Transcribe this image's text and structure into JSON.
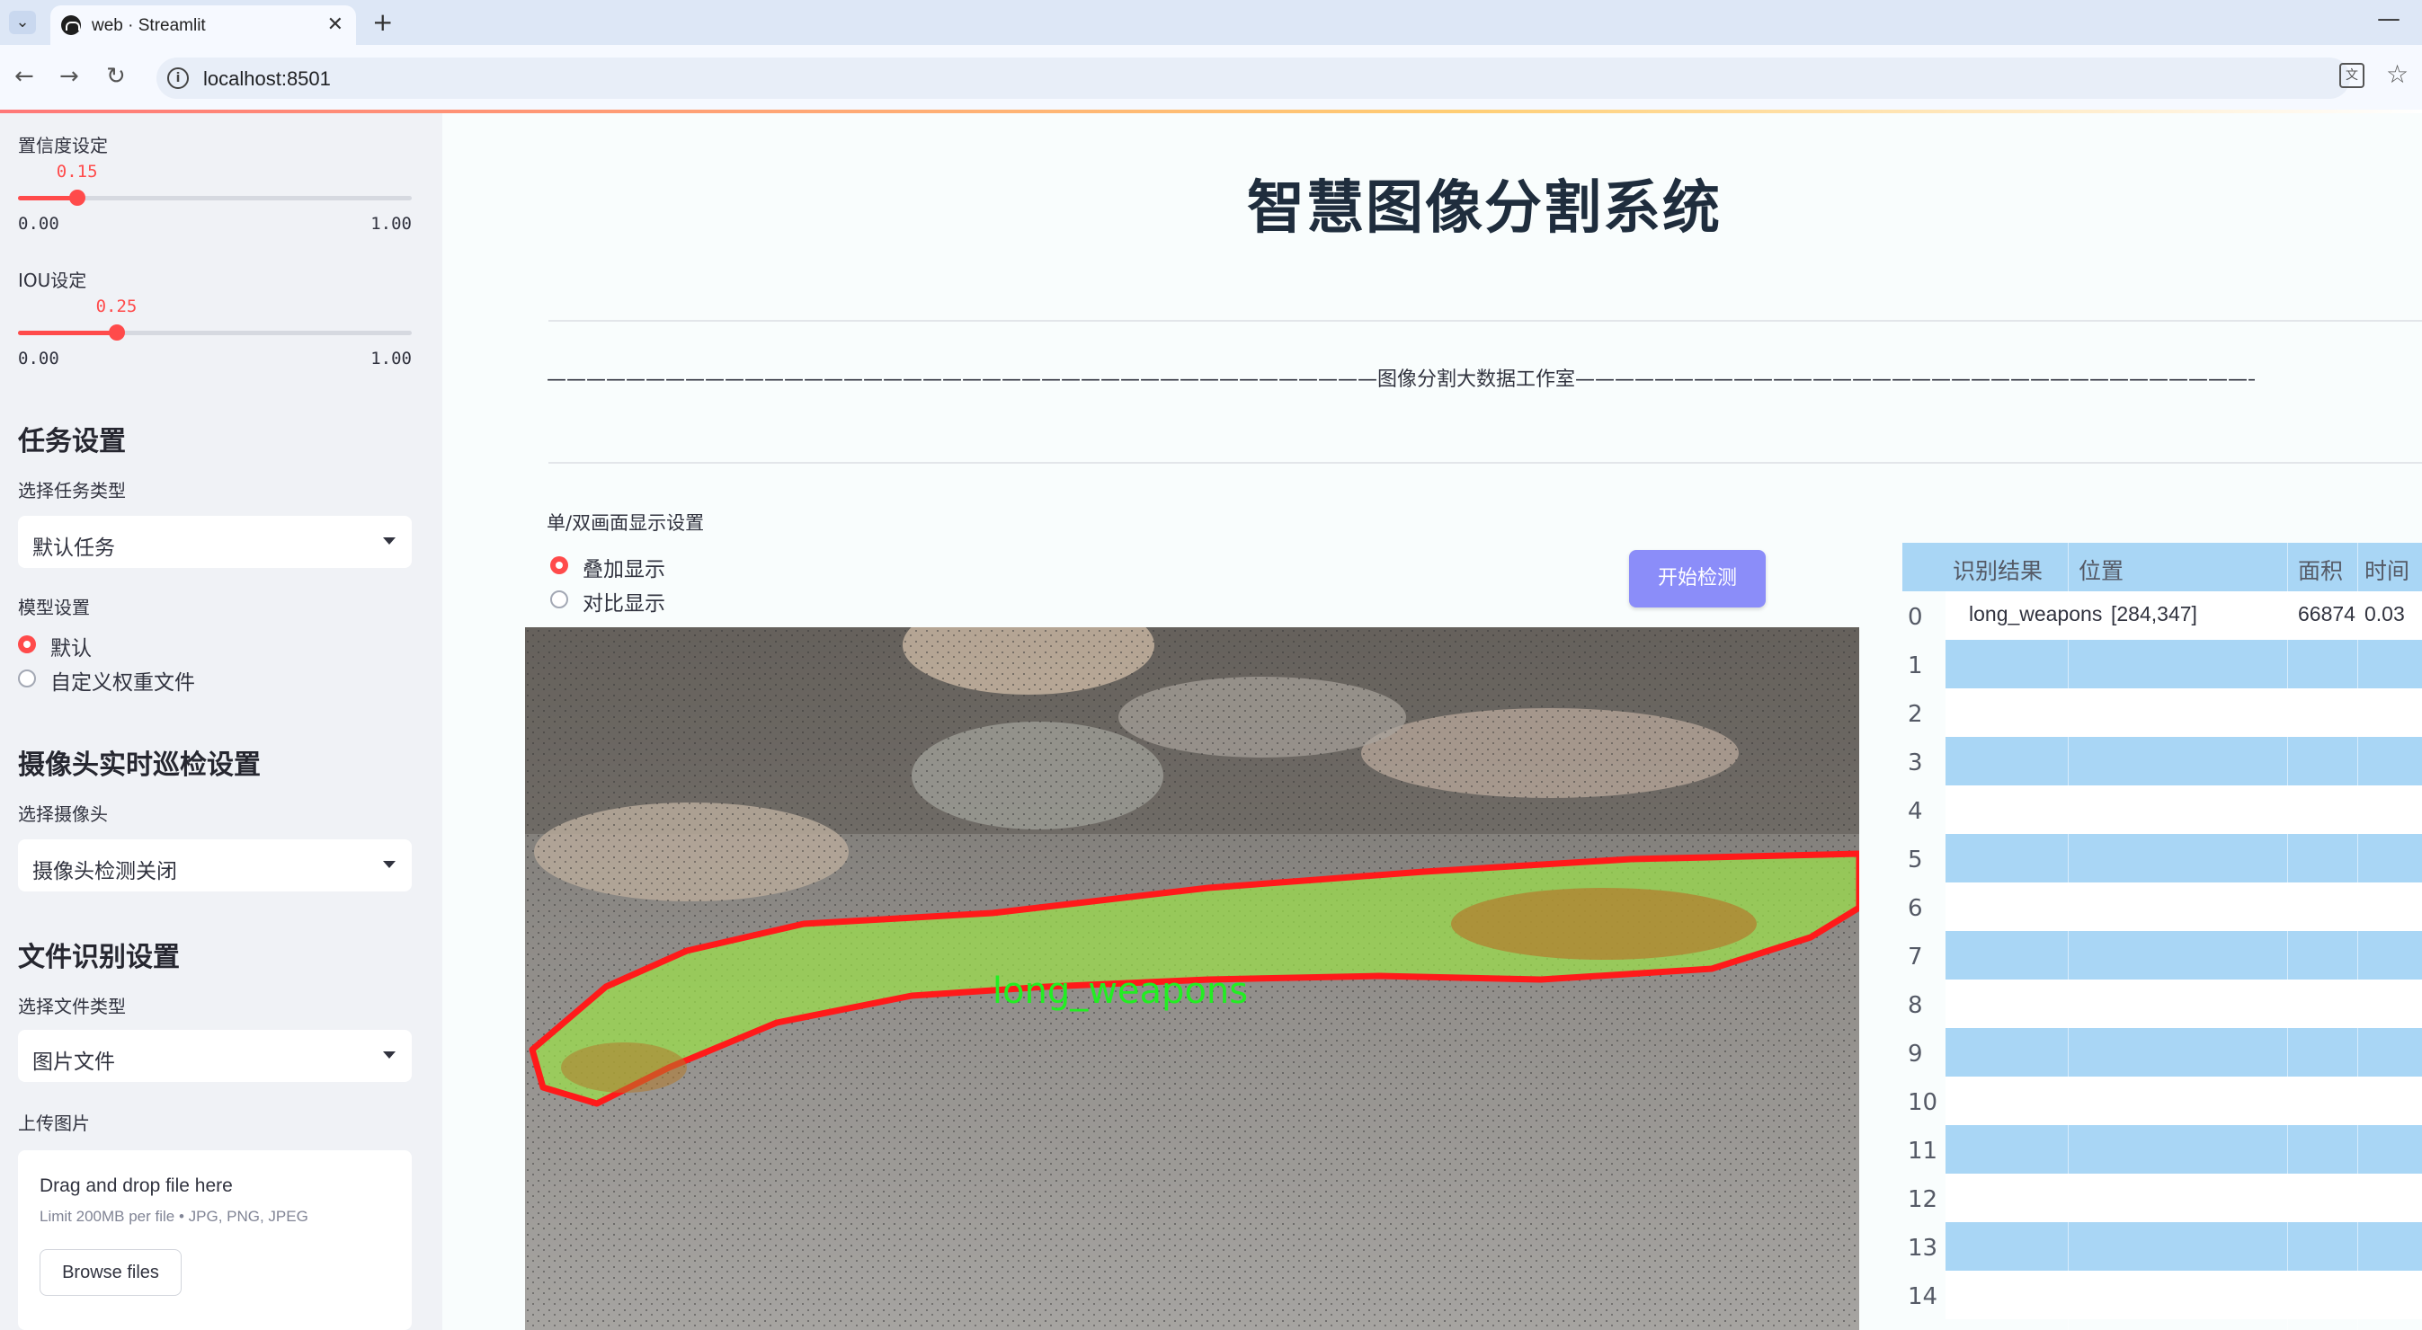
{
  "browser": {
    "tab_title": "web · Streamlit",
    "url": "localhost:8501"
  },
  "sidebar": {
    "confidence": {
      "label": "置信度设定",
      "value": "0.15",
      "min": "0.00",
      "max": "1.00",
      "fraction": 0.15
    },
    "iou": {
      "label": "IOU设定",
      "value": "0.25",
      "min": "0.00",
      "max": "1.00",
      "fraction": 0.25
    },
    "task": {
      "heading": "任务设置",
      "label": "选择任务类型",
      "selected": "默认任务"
    },
    "model": {
      "label": "模型设置",
      "options": [
        "默认",
        "自定义权重文件"
      ],
      "selected_index": 0
    },
    "camera": {
      "heading": "摄像头实时巡检设置",
      "label": "选择摄像头",
      "selected": "摄像头检测关闭"
    },
    "file": {
      "heading": "文件识别设置",
      "label": "选择文件类型",
      "selected": "图片文件"
    },
    "upload": {
      "label": "上传图片",
      "title": "Drag and drop file here",
      "limit": "Limit 200MB per file • JPG, PNG, JPEG",
      "button": "Browse files"
    }
  },
  "main": {
    "title": "智慧图像分割系统",
    "studio_line": "——————————————————————————————————————————图像分割大数据工作室——————————————————————————————————————————",
    "display_label": "单/双画面显示设置",
    "display_options": [
      "叠加显示",
      "对比显示"
    ],
    "display_selected_index": 0,
    "start_button": "开始检测",
    "detection_label": "long_weapons"
  },
  "table": {
    "columns": [
      "识别结果",
      "位置",
      "面积",
      "时间"
    ],
    "rows": [
      {
        "idx": "0",
        "result": "long_weapons",
        "position": "[284,347]",
        "area": "66874",
        "time": "0.03"
      },
      {
        "idx": "1"
      },
      {
        "idx": "2"
      },
      {
        "idx": "3"
      },
      {
        "idx": "4"
      },
      {
        "idx": "5"
      },
      {
        "idx": "6"
      },
      {
        "idx": "7"
      },
      {
        "idx": "8"
      },
      {
        "idx": "9"
      },
      {
        "idx": "10"
      },
      {
        "idx": "11"
      },
      {
        "idx": "12"
      },
      {
        "idx": "13"
      },
      {
        "idx": "14"
      }
    ]
  },
  "colors": {
    "accent": "#ff4b4b",
    "button": "#8b8df9",
    "table_stripe": "#a9d6f5",
    "mask": "#9be04a",
    "outline": "#ff1a1a",
    "label": "#22ee22"
  }
}
